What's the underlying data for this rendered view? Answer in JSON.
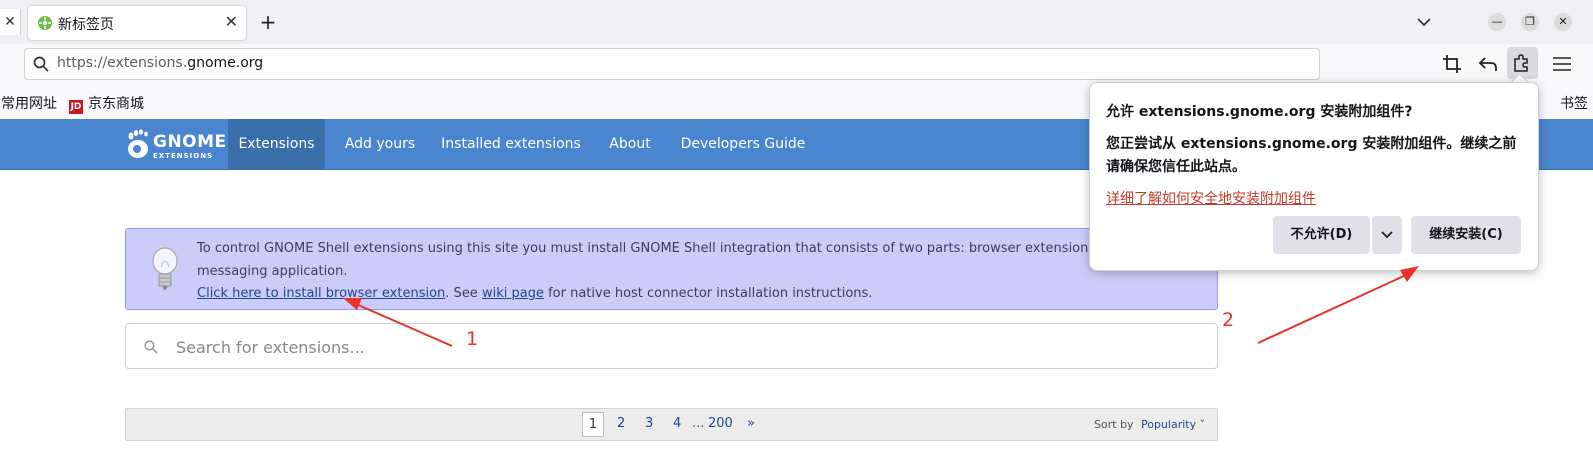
{
  "tabs": {
    "left_close_glyph": "✕",
    "active_title": "新标签页",
    "close_glyph": "✕",
    "new_tab_glyph": "+"
  },
  "window_controls": {
    "minimize": "—",
    "maximize": "❐",
    "close": "✕"
  },
  "navbar": {
    "url_scheme": "https://extensions.",
    "url_host": "gnome.org"
  },
  "bookmarks": {
    "items": [
      {
        "label": "常用网址"
      },
      {
        "label": "京东商城",
        "icon_text": "JD"
      }
    ],
    "overflow_label": "书签"
  },
  "gnome_site": {
    "logo_line1": "GNOME",
    "logo_line2": "EXTENSIONS",
    "nav": [
      "Extensions",
      "Add yours",
      "Installed extensions",
      "About",
      "Developers Guide"
    ],
    "active_nav": "Extensions",
    "banner": {
      "text1": "To control GNOME Shell extensions using this site you must install GNOME Shell integration that consists of two parts: browser extension and native host messaging application.",
      "install_link": "Click here to install browser extension",
      "see_text": ". See ",
      "wiki_link": "wiki page",
      "text2": " for native host connector installation instructions."
    },
    "search_placeholder": "Search for extensions...",
    "pagination": {
      "current": "1",
      "pages": [
        "2",
        "3",
        "4"
      ],
      "ellipsis": "...",
      "last": "200",
      "next": "»",
      "sort_label": "Sort by",
      "sort_value": "Popularity ˅"
    }
  },
  "popup": {
    "title": "允许 extensions.gnome.org 安装附加组件?",
    "body": "您正尝试从 extensions.gnome.org 安装附加组件。继续之前请确保您信任此站点。",
    "learn_more": "详细了解如何安全地安装附加组件",
    "deny_label": "不允许(D)",
    "allow_label": "继续安装(C)"
  },
  "annotations": {
    "label1": "1",
    "label2": "2",
    "color": "#e8332a"
  },
  "colors": {
    "gnome_header": "#4a86cf",
    "banner_bg": "#ccccfb",
    "link": "#204a87"
  }
}
